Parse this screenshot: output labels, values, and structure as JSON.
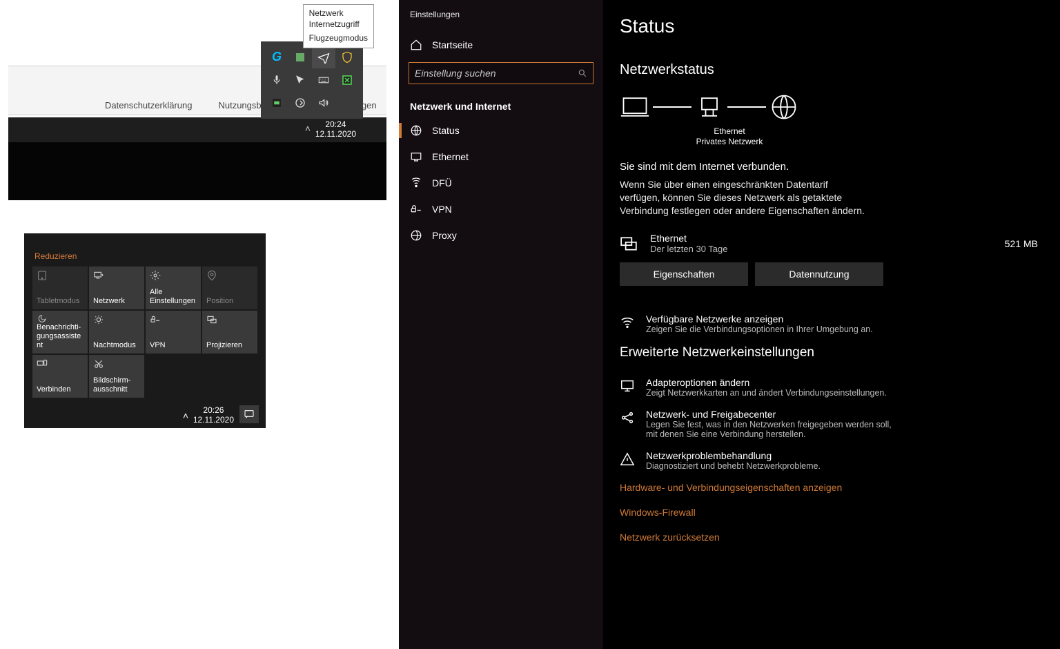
{
  "tooltip": {
    "l1": "Netzwerk",
    "l2": "Internetzugriff",
    "l3": "Flugzeugmodus"
  },
  "footerlinks": {
    "privacy": "Datenschutzerklärung",
    "terms": "Nutzungsbe",
    "more": "gen"
  },
  "tb1": {
    "time": "20:24",
    "date": "12.11.2020"
  },
  "tb2": {
    "time": "20:26",
    "date": "12.11.2020"
  },
  "action": {
    "reduce": "Reduzieren",
    "tiles": [
      {
        "label": "Tabletmodus"
      },
      {
        "label": "Netzwerk"
      },
      {
        "label": "Alle Einstellungen"
      },
      {
        "label": "Position"
      },
      {
        "label": "Benachrichti-gungsassistent"
      },
      {
        "label": "Nachtmodus"
      },
      {
        "label": "VPN"
      },
      {
        "label": "Projizieren"
      },
      {
        "label": "Verbinden"
      },
      {
        "label": "Bildschirm-ausschnitt"
      }
    ]
  },
  "settings": {
    "header": "Einstellungen",
    "home": "Startseite",
    "search_ph": "Einstellung suchen",
    "section": "Netzwerk und Internet",
    "nav": [
      {
        "label": "Status"
      },
      {
        "label": "Ethernet"
      },
      {
        "label": "DFÜ"
      },
      {
        "label": "VPN"
      },
      {
        "label": "Proxy"
      }
    ],
    "main": {
      "title": "Status",
      "h2": "Netzwerkstatus",
      "diag_eth": "Ethernet",
      "diag_net": "Privates Netzwerk",
      "lead": "Sie sind mit dem Internet verbunden.",
      "para": "Wenn Sie über einen eingeschränkten Datentarif verfügen, können Sie dieses Netzwerk als getaktete Verbindung festlegen oder andere Eigenschaften ändern.",
      "usage": {
        "name": "Ethernet",
        "sub": "Der letzten 30 Tage",
        "val": "521 MB"
      },
      "btn_props": "Eigenschaften",
      "btn_usage": "Datennutzung",
      "avail": {
        "name": "Verfügbare Netzwerke anzeigen",
        "sub": "Zeigen Sie die Verbindungsoptionen in Ihrer Umgebung an."
      },
      "advanced": "Erweiterte Netzwerkeinstellungen",
      "adapter": {
        "name": "Adapteroptionen ändern",
        "sub": "Zeigt Netzwerkkarten an und ändert Verbindungseinstellungen."
      },
      "sharing": {
        "name": "Netzwerk- und Freigabecenter",
        "sub": "Legen Sie fest, was in den Netzwerken freigegeben werden soll, mit denen Sie eine Verbindung herstellen."
      },
      "trouble": {
        "name": "Netzwerkproblembehandlung",
        "sub": "Diagnostiziert und behebt Netzwerkprobleme."
      },
      "link_hw": "Hardware- und Verbindungseigenschaften anzeigen",
      "link_fw": "Windows-Firewall",
      "link_reset": "Netzwerk zurücksetzen"
    }
  }
}
